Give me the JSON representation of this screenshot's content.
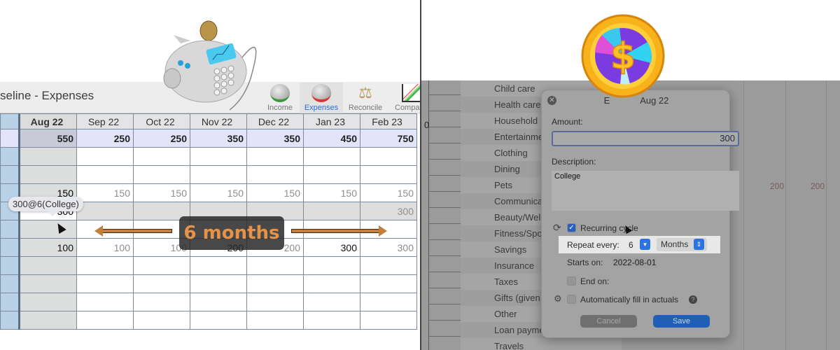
{
  "left": {
    "window_title": "seline - Expenses",
    "toolbar": [
      {
        "id": "income",
        "label": "Income",
        "active": false
      },
      {
        "id": "expenses",
        "label": "Expenses",
        "active": true
      },
      {
        "id": "reconcile",
        "label": "Reconcile",
        "active": false
      },
      {
        "id": "compare",
        "label": "Compa",
        "active": false
      }
    ],
    "columns": [
      "Aug 22",
      "Sep 22",
      "Oct 22",
      "Nov 22",
      "Dec 22",
      "Jan 23",
      "Feb 23"
    ],
    "totals": [
      "550",
      "250",
      "250",
      "350",
      "350",
      "450",
      "750"
    ],
    "rows": [
      [
        "",
        "",
        "",
        "",
        "",
        "",
        ""
      ],
      [
        "",
        "",
        "",
        "",
        "",
        "",
        ""
      ],
      [
        "150",
        "150",
        "150",
        "150",
        "150",
        "150",
        "150"
      ],
      [
        "300",
        "",
        "",
        "",
        "",
        "",
        "300"
      ],
      [
        "",
        "",
        "",
        "",
        "",
        "",
        ""
      ],
      [
        "100",
        "100",
        "100",
        "200",
        "200",
        "300",
        "300"
      ],
      [
        "",
        "",
        "",
        "",
        "",
        "",
        ""
      ],
      [
        "",
        "",
        "",
        "",
        "",
        "",
        ""
      ],
      [
        "",
        "",
        "",
        "",
        "",
        "",
        ""
      ],
      [
        "",
        "",
        "",
        "",
        "",
        "",
        ""
      ]
    ],
    "row6_bold": [
      true,
      false,
      false,
      true,
      false,
      true,
      false
    ],
    "tooltip": "300@6(College)",
    "annotation": "6 months",
    "colors": {
      "accent_orange": "#c47f3e",
      "sidebar_blue": "#b9d2e8",
      "total_row": "#e3e3fa"
    }
  },
  "right": {
    "left_col_value": "0",
    "categories": [
      "Child care",
      "Health care",
      "Household",
      "Entertainme",
      "Clothing",
      "Dining",
      "Pets",
      "Communica",
      "Beauty/Well",
      "Fitness/Spo",
      "Savings",
      "Insurance",
      "Taxes",
      "Gifts (given",
      "Other",
      "Loan payme",
      "Travels"
    ],
    "right_values": [
      "200",
      "200"
    ],
    "dialog": {
      "title_prefix": "E",
      "title_month": "Aug 22",
      "amount_label": "Amount:",
      "amount_value": "300",
      "description_label": "Description:",
      "description_value": "College",
      "recurring_label": "Recurring cycle",
      "recurring_checked": true,
      "repeat_label": "Repeat every:",
      "repeat_value": "6",
      "repeat_unit": "Months",
      "starts_label": "Starts on:",
      "starts_value": "2022-08-01",
      "end_label": "End on:",
      "end_checked": false,
      "autofill_label": "Automatically fill in actuals",
      "autofill_checked": false,
      "cancel_label": "Cancel",
      "save_label": "Save"
    },
    "colors": {
      "save_blue": "#1f5fb8",
      "checkbox_blue": "#2a5fc0"
    }
  }
}
